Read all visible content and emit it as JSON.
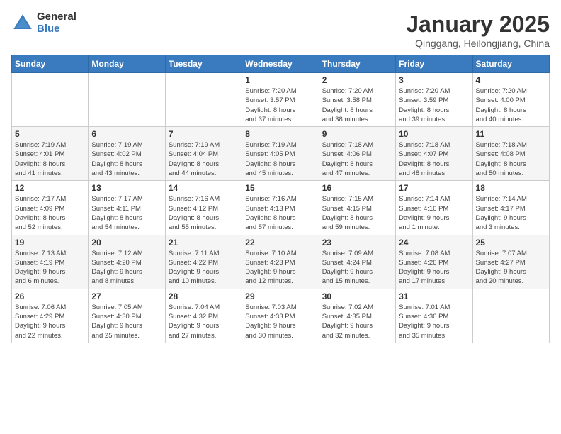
{
  "logo": {
    "general": "General",
    "blue": "Blue"
  },
  "header": {
    "month": "January 2025",
    "location": "Qinggang, Heilongjiang, China"
  },
  "weekdays": [
    "Sunday",
    "Monday",
    "Tuesday",
    "Wednesday",
    "Thursday",
    "Friday",
    "Saturday"
  ],
  "weeks": [
    [
      {
        "day": "",
        "info": ""
      },
      {
        "day": "",
        "info": ""
      },
      {
        "day": "",
        "info": ""
      },
      {
        "day": "1",
        "info": "Sunrise: 7:20 AM\nSunset: 3:57 PM\nDaylight: 8 hours\nand 37 minutes."
      },
      {
        "day": "2",
        "info": "Sunrise: 7:20 AM\nSunset: 3:58 PM\nDaylight: 8 hours\nand 38 minutes."
      },
      {
        "day": "3",
        "info": "Sunrise: 7:20 AM\nSunset: 3:59 PM\nDaylight: 8 hours\nand 39 minutes."
      },
      {
        "day": "4",
        "info": "Sunrise: 7:20 AM\nSunset: 4:00 PM\nDaylight: 8 hours\nand 40 minutes."
      }
    ],
    [
      {
        "day": "5",
        "info": "Sunrise: 7:19 AM\nSunset: 4:01 PM\nDaylight: 8 hours\nand 41 minutes."
      },
      {
        "day": "6",
        "info": "Sunrise: 7:19 AM\nSunset: 4:02 PM\nDaylight: 8 hours\nand 43 minutes."
      },
      {
        "day": "7",
        "info": "Sunrise: 7:19 AM\nSunset: 4:04 PM\nDaylight: 8 hours\nand 44 minutes."
      },
      {
        "day": "8",
        "info": "Sunrise: 7:19 AM\nSunset: 4:05 PM\nDaylight: 8 hours\nand 45 minutes."
      },
      {
        "day": "9",
        "info": "Sunrise: 7:18 AM\nSunset: 4:06 PM\nDaylight: 8 hours\nand 47 minutes."
      },
      {
        "day": "10",
        "info": "Sunrise: 7:18 AM\nSunset: 4:07 PM\nDaylight: 8 hours\nand 48 minutes."
      },
      {
        "day": "11",
        "info": "Sunrise: 7:18 AM\nSunset: 4:08 PM\nDaylight: 8 hours\nand 50 minutes."
      }
    ],
    [
      {
        "day": "12",
        "info": "Sunrise: 7:17 AM\nSunset: 4:09 PM\nDaylight: 8 hours\nand 52 minutes."
      },
      {
        "day": "13",
        "info": "Sunrise: 7:17 AM\nSunset: 4:11 PM\nDaylight: 8 hours\nand 54 minutes."
      },
      {
        "day": "14",
        "info": "Sunrise: 7:16 AM\nSunset: 4:12 PM\nDaylight: 8 hours\nand 55 minutes."
      },
      {
        "day": "15",
        "info": "Sunrise: 7:16 AM\nSunset: 4:13 PM\nDaylight: 8 hours\nand 57 minutes."
      },
      {
        "day": "16",
        "info": "Sunrise: 7:15 AM\nSunset: 4:15 PM\nDaylight: 8 hours\nand 59 minutes."
      },
      {
        "day": "17",
        "info": "Sunrise: 7:14 AM\nSunset: 4:16 PM\nDaylight: 9 hours\nand 1 minute."
      },
      {
        "day": "18",
        "info": "Sunrise: 7:14 AM\nSunset: 4:17 PM\nDaylight: 9 hours\nand 3 minutes."
      }
    ],
    [
      {
        "day": "19",
        "info": "Sunrise: 7:13 AM\nSunset: 4:19 PM\nDaylight: 9 hours\nand 6 minutes."
      },
      {
        "day": "20",
        "info": "Sunrise: 7:12 AM\nSunset: 4:20 PM\nDaylight: 9 hours\nand 8 minutes."
      },
      {
        "day": "21",
        "info": "Sunrise: 7:11 AM\nSunset: 4:22 PM\nDaylight: 9 hours\nand 10 minutes."
      },
      {
        "day": "22",
        "info": "Sunrise: 7:10 AM\nSunset: 4:23 PM\nDaylight: 9 hours\nand 12 minutes."
      },
      {
        "day": "23",
        "info": "Sunrise: 7:09 AM\nSunset: 4:24 PM\nDaylight: 9 hours\nand 15 minutes."
      },
      {
        "day": "24",
        "info": "Sunrise: 7:08 AM\nSunset: 4:26 PM\nDaylight: 9 hours\nand 17 minutes."
      },
      {
        "day": "25",
        "info": "Sunrise: 7:07 AM\nSunset: 4:27 PM\nDaylight: 9 hours\nand 20 minutes."
      }
    ],
    [
      {
        "day": "26",
        "info": "Sunrise: 7:06 AM\nSunset: 4:29 PM\nDaylight: 9 hours\nand 22 minutes."
      },
      {
        "day": "27",
        "info": "Sunrise: 7:05 AM\nSunset: 4:30 PM\nDaylight: 9 hours\nand 25 minutes."
      },
      {
        "day": "28",
        "info": "Sunrise: 7:04 AM\nSunset: 4:32 PM\nDaylight: 9 hours\nand 27 minutes."
      },
      {
        "day": "29",
        "info": "Sunrise: 7:03 AM\nSunset: 4:33 PM\nDaylight: 9 hours\nand 30 minutes."
      },
      {
        "day": "30",
        "info": "Sunrise: 7:02 AM\nSunset: 4:35 PM\nDaylight: 9 hours\nand 32 minutes."
      },
      {
        "day": "31",
        "info": "Sunrise: 7:01 AM\nSunset: 4:36 PM\nDaylight: 9 hours\nand 35 minutes."
      },
      {
        "day": "",
        "info": ""
      }
    ]
  ]
}
